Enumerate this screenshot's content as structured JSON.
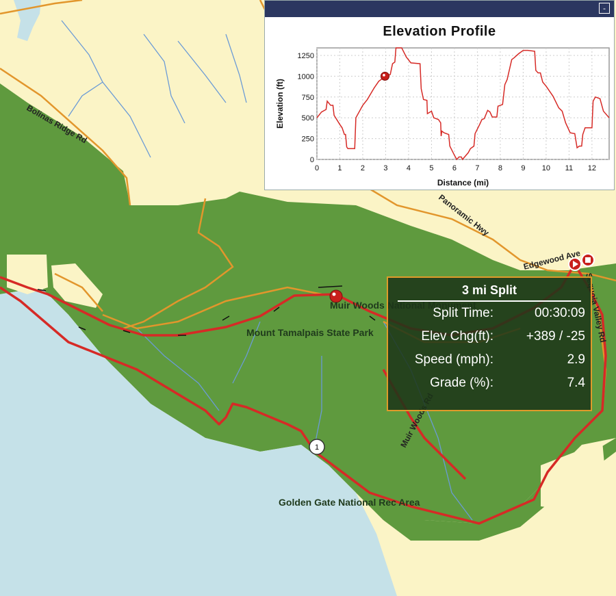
{
  "map": {
    "labels": {
      "park1": "Mount Tamalpais State Park",
      "park2": "Golden Gate National Rec Area",
      "monument": "Muir Woods National Monument",
      "road1": "Bolinas Ridge Rd",
      "road2": "Panoramic Hwy",
      "road3": "Edgewood Ave",
      "road4": "Sequoia Valley Rd",
      "road5": "Muir Woods Rd",
      "highway_shield": "1"
    },
    "colors": {
      "land": "#fbf4c6",
      "park": "#5f9a3e",
      "water": "#c5e1e8",
      "route": "#d62a26",
      "road": "#e2962c",
      "stream": "#6b9bd6"
    },
    "markers": [
      "start-marker",
      "end-marker",
      "position-marker"
    ]
  },
  "elevation_panel": {
    "minimize_label": "-",
    "title": "Elevation Profile"
  },
  "chart_data": {
    "type": "line",
    "title": "Elevation Profile",
    "xlabel": "Distance (mi)",
    "ylabel": "Elevation (ft)",
    "xlim": [
      0,
      12.75
    ],
    "ylim": [
      0,
      1340
    ],
    "xticks": [
      0,
      1,
      2,
      3,
      4,
      5,
      6,
      7,
      8,
      9,
      10,
      11,
      12
    ],
    "yticks": [
      0,
      250,
      500,
      750,
      1000,
      1250
    ],
    "grid": true,
    "line_color": "#d62a26",
    "marker": {
      "x": 2.97,
      "y": 1000
    },
    "x": [
      0,
      0.2,
      0.4,
      0.45,
      0.6,
      0.7,
      0.75,
      1.0,
      1.1,
      1.2,
      1.25,
      1.3,
      1.35,
      1.65,
      1.7,
      2.0,
      2.2,
      2.5,
      2.7,
      3.0,
      3.2,
      3.3,
      3.4,
      3.45,
      3.7,
      3.9,
      4.1,
      4.5,
      4.55,
      4.65,
      4.8,
      4.82,
      5.0,
      5.1,
      5.3,
      5.4,
      5.42,
      5.45,
      5.55,
      5.75,
      5.8,
      6.0,
      6.1,
      6.2,
      6.3,
      6.35,
      6.6,
      6.7,
      6.85,
      6.9,
      7.1,
      7.2,
      7.3,
      7.45,
      7.55,
      7.65,
      7.85,
      7.9,
      8.0,
      8.1,
      8.2,
      8.3,
      8.5,
      8.6,
      8.8,
      9.0,
      9.2,
      9.5,
      9.55,
      9.65,
      9.75,
      9.85,
      10.0,
      10.2,
      10.3,
      10.55,
      10.7,
      10.85,
      11.05,
      11.25,
      11.35,
      11.45,
      11.55,
      11.6,
      11.7,
      12.0,
      12.05,
      12.15,
      12.35,
      12.5,
      12.75
    ],
    "y": [
      500,
      570,
      600,
      700,
      650,
      650,
      530,
      420,
      380,
      300,
      300,
      150,
      130,
      130,
      500,
      650,
      720,
      860,
      940,
      1000,
      1020,
      1150,
      1170,
      1340,
      1340,
      1230,
      1160,
      1150,
      850,
      720,
      710,
      550,
      580,
      500,
      480,
      440,
      280,
      340,
      320,
      300,
      160,
      50,
      0,
      30,
      30,
      0,
      80,
      130,
      160,
      310,
      420,
      480,
      490,
      590,
      570,
      510,
      510,
      640,
      650,
      660,
      900,
      960,
      1200,
      1220,
      1270,
      1310,
      1310,
      1300,
      1070,
      1040,
      1040,
      930,
      880,
      800,
      760,
      620,
      580,
      440,
      320,
      310,
      140,
      160,
      160,
      300,
      380,
      380,
      700,
      750,
      730,
      580,
      500
    ]
  },
  "split": {
    "title": "3 mi Split",
    "rows": [
      {
        "label": "Split Time:",
        "value": "00:30:09"
      },
      {
        "label": "Elev Chg(ft):",
        "value": "+389 / -25"
      },
      {
        "label": "Speed (mph):",
        "value": "2.9"
      },
      {
        "label": "Grade (%):",
        "value": "7.4"
      }
    ]
  }
}
